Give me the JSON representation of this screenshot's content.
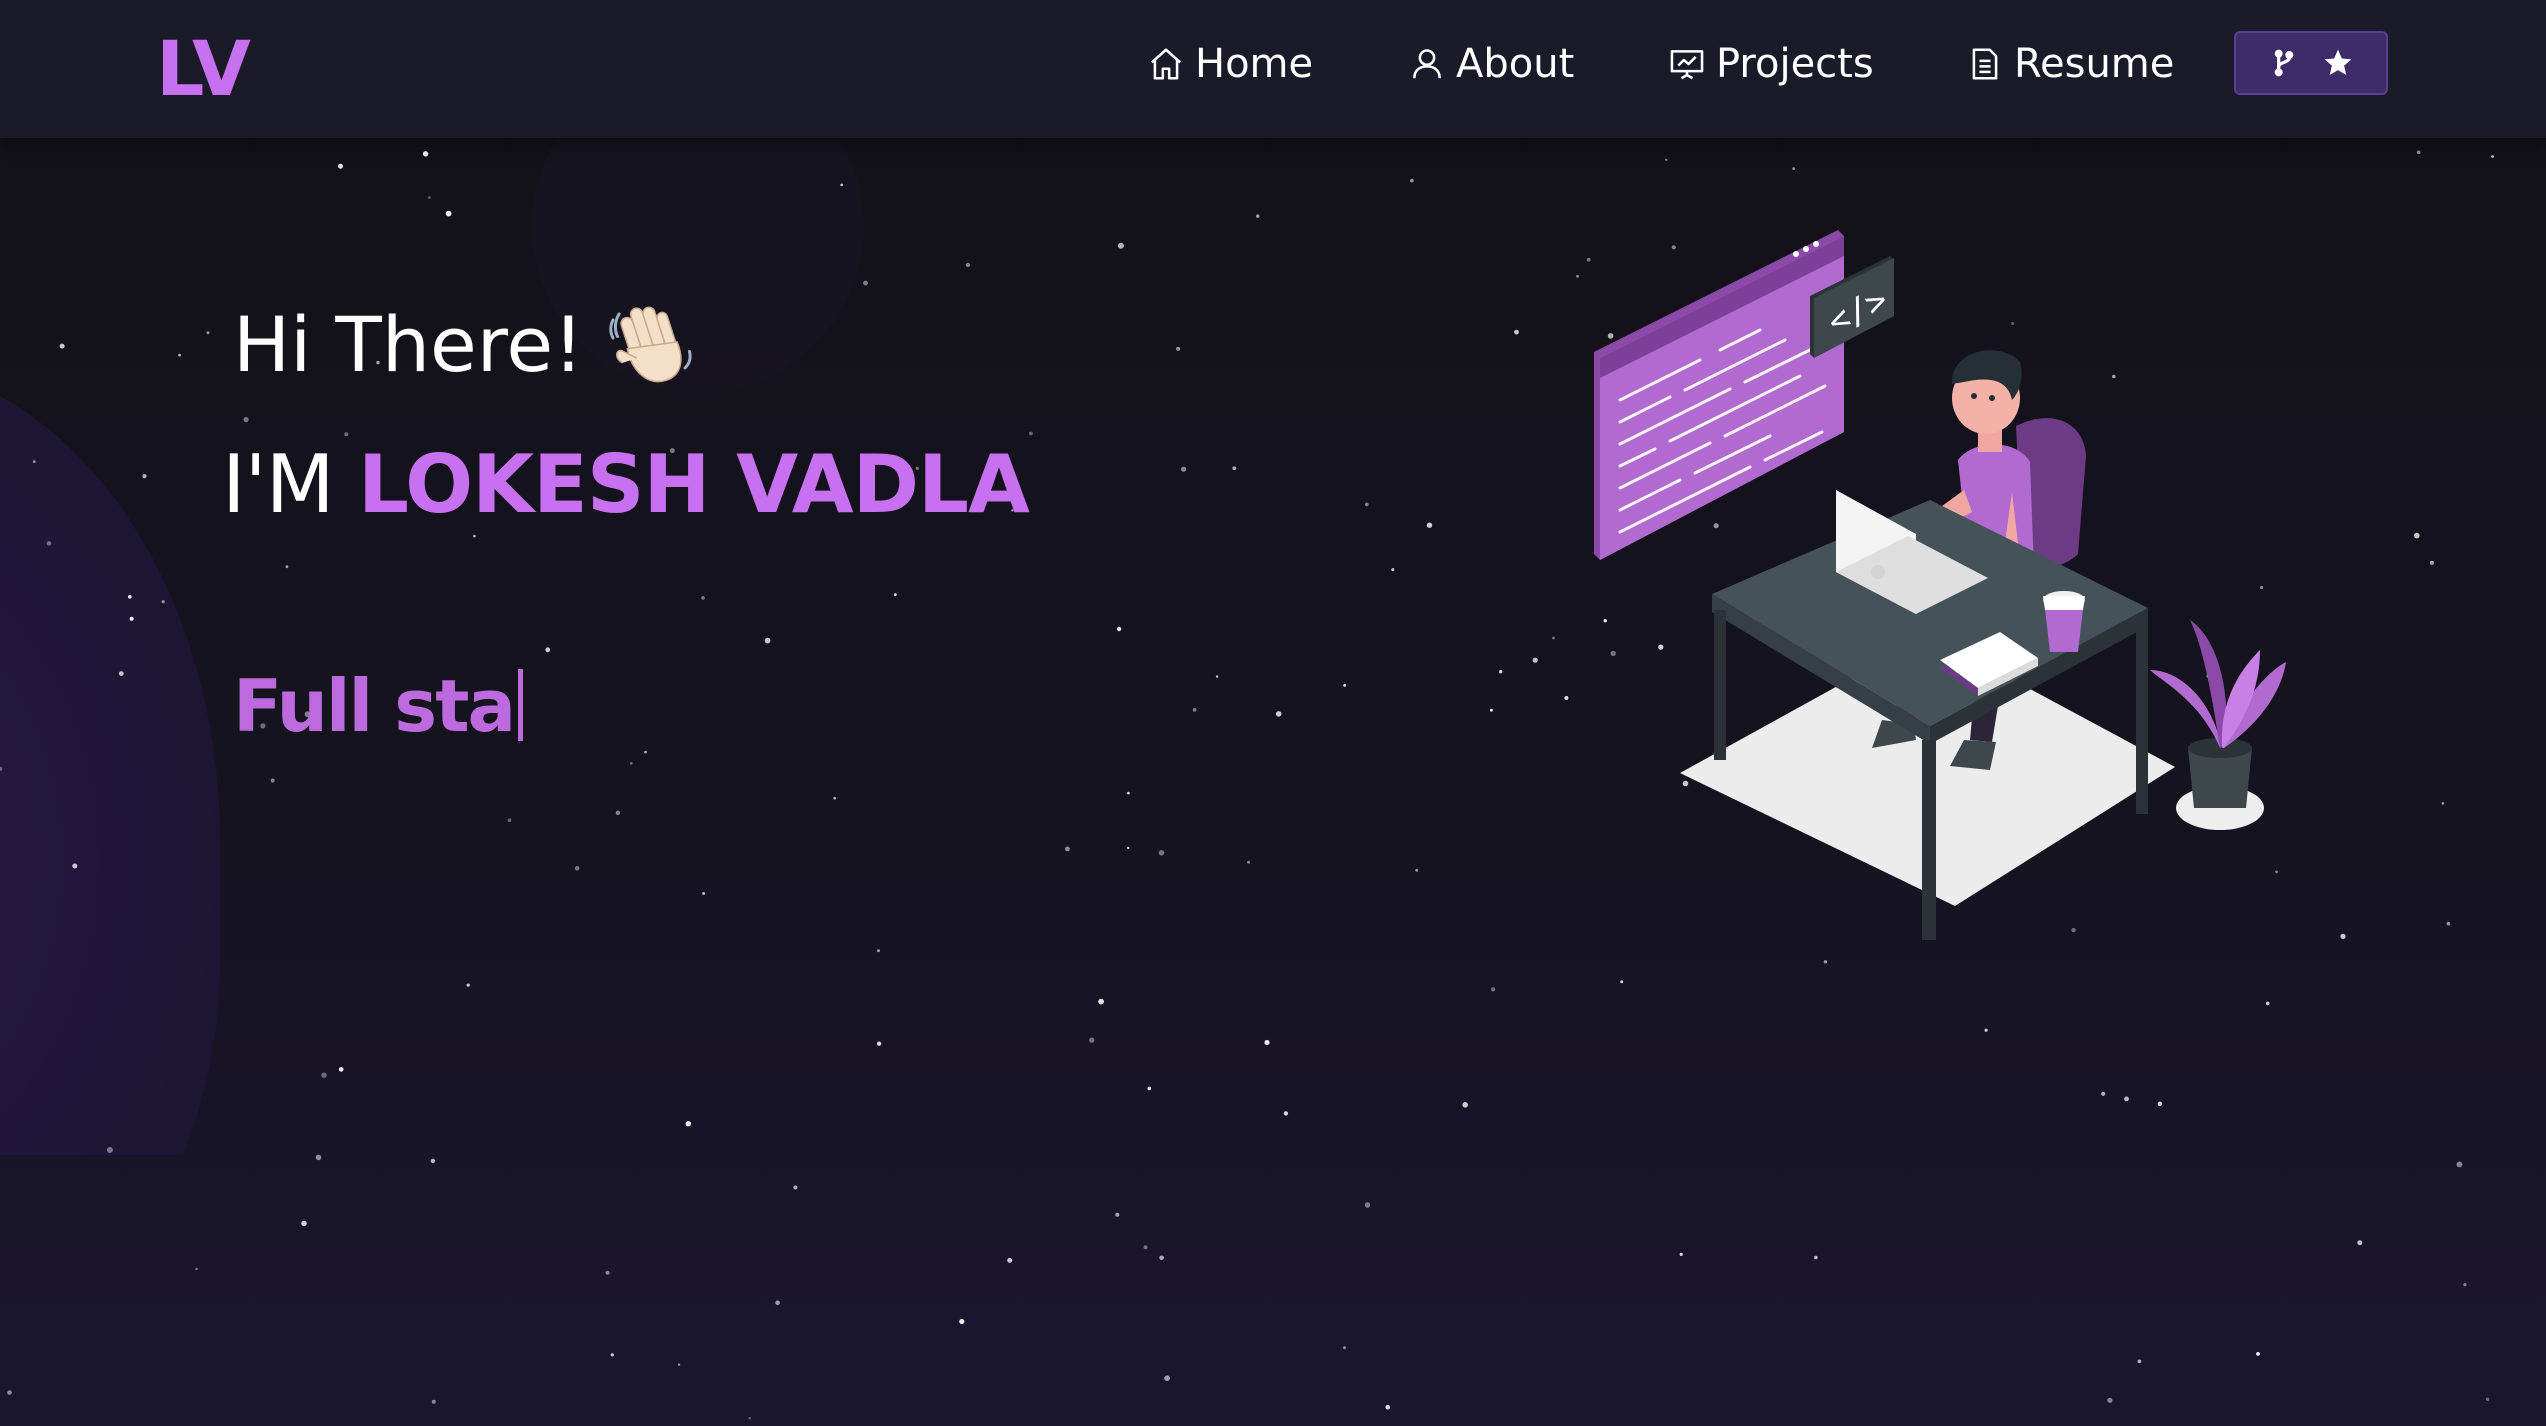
{
  "brand": {
    "logo_text": "LV",
    "accent_color": "#c770f0"
  },
  "navbar": {
    "items": [
      {
        "label": "Home",
        "icon": "home-icon"
      },
      {
        "label": "About",
        "icon": "user-icon"
      },
      {
        "label": "Projects",
        "icon": "presentation-chart-icon"
      },
      {
        "label": "Resume",
        "icon": "document-icon"
      }
    ],
    "github_button": {
      "icons": [
        "git-fork-icon",
        "star-icon"
      ],
      "background": "#3e2b6a"
    }
  },
  "hero": {
    "greeting": "Hi There!",
    "greeting_emoji": "waving-hand-icon",
    "intro_prefix": "I'M",
    "name": "LOKESH VADLA",
    "typewriter_text": "Full sta",
    "illustration": "developer-at-desk-illustration"
  },
  "colors": {
    "background": "#121117",
    "navbar": "#1b1a28",
    "typewriter": "#be6adf"
  }
}
